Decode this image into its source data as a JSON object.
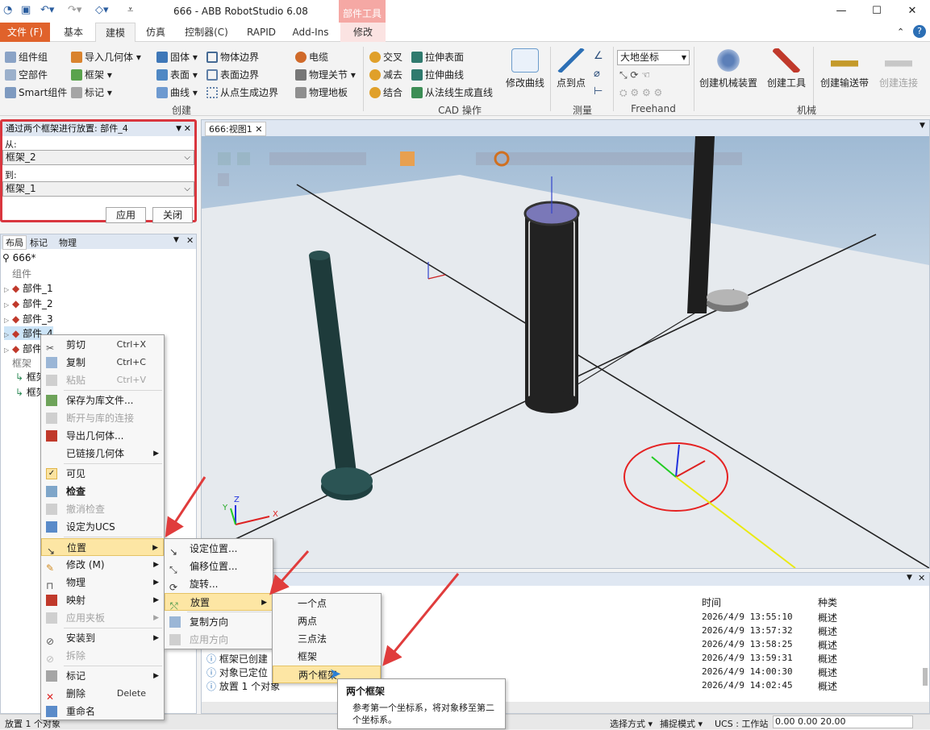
{
  "window": {
    "title": "666 - ABB RobotStudio 6.08",
    "context_tab": "部件工具",
    "min": "—",
    "max": "☐",
    "close": "✕"
  },
  "tabs": [
    {
      "label": "文件 (F)"
    },
    {
      "label": "基本"
    },
    {
      "label": "建模"
    },
    {
      "label": "仿真"
    },
    {
      "label": "控制器(C)"
    },
    {
      "label": "RAPID"
    },
    {
      "label": "Add-Ins"
    },
    {
      "label": "修改"
    }
  ],
  "ribbon": {
    "create": {
      "group_label": "创建",
      "items": [
        "组件组",
        "空部件",
        "Smart组件",
        "导入几何体 ▾",
        "框架 ▾",
        "标记 ▾",
        "固体 ▾",
        "表面 ▾",
        "曲线 ▾",
        "物体边界",
        "表面边界",
        "从点生成边界",
        "电缆",
        "物理关节 ▾",
        "物理地板"
      ]
    },
    "cad": {
      "group_label": "CAD 操作",
      "items": [
        "交叉",
        "减去",
        "结合",
        "拉伸表面",
        "拉伸曲线",
        "从法线生成直线"
      ],
      "big": "修改曲线"
    },
    "measure": {
      "group_label": "测量",
      "big": "点到点"
    },
    "freehand": {
      "group_label": "Freehand",
      "coord": "大地坐标"
    },
    "mechanism": {
      "group_label": "机械",
      "buttons": [
        "创建机械装置",
        "创建工具",
        "创建输送带",
        "创建连接"
      ]
    }
  },
  "place_panel": {
    "title": "通过两个框架进行放置: 部件_4",
    "from_label": "从:",
    "from_value": "框架_2",
    "to_label": "到:",
    "to_value": "框架_1",
    "apply": "应用",
    "close": "关闭"
  },
  "layout_panel": {
    "tabs": [
      "布局",
      "标记",
      "物理"
    ],
    "root": "666*",
    "section_components": "组件",
    "parts": [
      "部件_1",
      "部件_2",
      "部件_3",
      "部件_4",
      "部件"
    ],
    "section_frames": "框架",
    "frames": [
      "框架",
      "框架"
    ]
  },
  "viewport": {
    "tab": "666:视图1",
    "axis_x": "X",
    "axis_y": "Y",
    "axis_z": "Z"
  },
  "context_menu": {
    "items": [
      {
        "label": "剪切",
        "shortcut": "Ctrl+X"
      },
      {
        "label": "复制",
        "shortcut": "Ctrl+C"
      },
      {
        "label": "粘贴",
        "shortcut": "Ctrl+V"
      },
      {
        "label": "保存为库文件..."
      },
      {
        "label": "断开与库的连接"
      },
      {
        "label": "导出几何体..."
      },
      {
        "label": "已链接几何体"
      },
      {
        "label": "可见"
      },
      {
        "label": "检查"
      },
      {
        "label": "撤消检查"
      },
      {
        "label": "设定为UCS"
      },
      {
        "label": "位置"
      },
      {
        "label": "修改 (M)"
      },
      {
        "label": "物理"
      },
      {
        "label": "映射"
      },
      {
        "label": "应用夹板"
      },
      {
        "label": "安装到"
      },
      {
        "label": "拆除"
      },
      {
        "label": "标记"
      },
      {
        "label": "删除",
        "shortcut": "Delete"
      },
      {
        "label": "重命名"
      }
    ]
  },
  "position_menu": {
    "items": [
      {
        "label": "设定位置..."
      },
      {
        "label": "偏移位置..."
      },
      {
        "label": "旋转..."
      },
      {
        "label": "放置"
      },
      {
        "label": "复制方向"
      },
      {
        "label": "应用方向"
      }
    ]
  },
  "place_menu": {
    "items": [
      {
        "label": "一个点"
      },
      {
        "label": "两点"
      },
      {
        "label": "三点法"
      },
      {
        "label": "框架"
      },
      {
        "label": "两个框架"
      }
    ]
  },
  "tooltip": {
    "title": "两个框架",
    "text": "参考第一个坐标系，将对象移至第二个坐标系。"
  },
  "output": {
    "col_time": "时间",
    "col_type": "种类",
    "messages": [
      "框架已创建",
      "对象已定位",
      "放置 1 个对象"
    ],
    "rows": [
      {
        "time": "2026/4/9 13:55:10",
        "type": "概述"
      },
      {
        "time": "2026/4/9 13:57:32",
        "type": "概述"
      },
      {
        "time": "2026/4/9 13:58:25",
        "type": "概述"
      },
      {
        "time": "2026/4/9 13:59:31",
        "type": "概述"
      },
      {
        "time": "2026/4/9 14:00:30",
        "type": "概述"
      },
      {
        "time": "2026/4/9 14:02:45",
        "type": "概述"
      }
    ]
  },
  "statusbar": {
    "left": "放置 1 个对象",
    "selection": "选择方式 ▾",
    "snap": "捕捉模式 ▾",
    "ucs": "UCS : 工作站",
    "coords": "0.00  0.00  20.00"
  },
  "colors": {
    "file_tab": "#e0622b",
    "highlight": "#fde6a4",
    "annotation": "#e03c3c"
  }
}
